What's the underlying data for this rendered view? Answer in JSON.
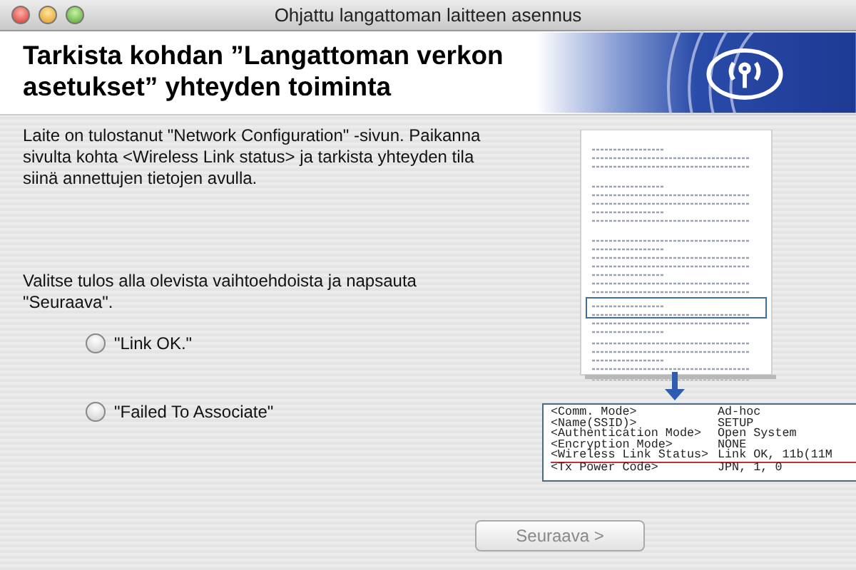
{
  "window": {
    "title": "Ohjattu langattoman laitteen asennus"
  },
  "header": {
    "title": "Tarkista kohdan ”Langattoman verkon asetukset” yhteyden toiminta"
  },
  "instructions": [
    "Laite on tulostanut \"Network Configuration\" -sivun. Paikanna sivulta kohta <Wireless Link status> ja tarkista yhteyden tila siinä annettujen tietojen avulla.",
    "Valitse tulos alla olevista vaihtoehdoista ja napsauta \"Seuraava\"."
  ],
  "options": [
    {
      "label": "\"Link OK.\"",
      "selected": false
    },
    {
      "label": "\"Failed To Associate\"",
      "selected": false
    }
  ],
  "callout": {
    "rows": [
      {
        "key": "<Comm. Mode>",
        "value": "Ad-hoc",
        "highlighted": false
      },
      {
        "key": "<Name(SSID)>",
        "value": "SETUP",
        "highlighted": false
      },
      {
        "key": "<Authentication Mode>",
        "value": "Open System",
        "highlighted": false
      },
      {
        "key": "<Encryption Mode>",
        "value": "NONE",
        "highlighted": false
      },
      {
        "key": "<Wireless Link Status>",
        "value": "Link OK, 11b(11M",
        "highlighted": true
      },
      {
        "key": "<Tx Power Code>",
        "value": "JPN, 1, 0",
        "highlighted": false
      }
    ]
  },
  "next_button": {
    "label": "Seuraava >",
    "disabled": true
  }
}
